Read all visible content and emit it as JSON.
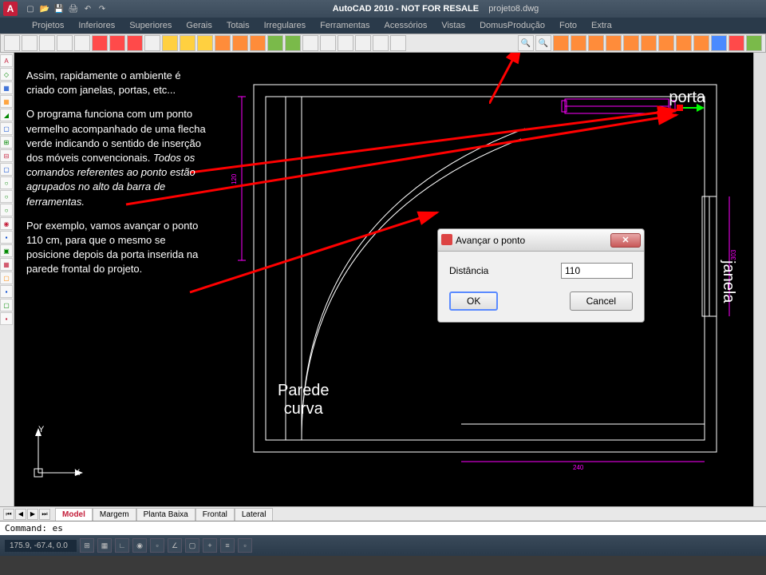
{
  "title": {
    "app": "AutoCAD 2010 - NOT FOR RESALE",
    "file": "projeto8.dwg",
    "logo": "A"
  },
  "menus": [
    "Projetos",
    "Inferiores",
    "Superiores",
    "Gerais",
    "Totais",
    "Irregulares",
    "Ferramentas",
    "Acessórios",
    "Vistas",
    "DomusProdução",
    "Foto",
    "Extra"
  ],
  "annotation": {
    "p1": "Assim, rapidamente o ambiente é criado com janelas, portas, etc...",
    "p2": "O programa funciona com um ponto vermelho acompanhado de uma flecha verde indicando o sentido de inserção dos móveis convencionais.",
    "p3": "Todos os comandos referentes ao ponto estão agrupados no alto da barra de ferramentas.",
    "p4": "Por exemplo, vamos avançar o ponto 110 cm, para que o mesmo se posicione depois da porta inserida na parede frontal do projeto."
  },
  "labels": {
    "porta": "porta",
    "janela": "janela",
    "parede": "Parede\ncurva"
  },
  "dialog": {
    "title": "Avançar o ponto",
    "field_label": "Distância",
    "field_value": "110",
    "ok": "OK",
    "cancel": "Cancel"
  },
  "tabs": {
    "active": "Model",
    "others": [
      "Margem",
      "Planta Baixa",
      "Frontal",
      "Lateral"
    ]
  },
  "command": "Command: es",
  "status": {
    "coords": "175.9, -67.4, 0.0"
  },
  "ucs": {
    "x": "X",
    "y": "Y"
  },
  "dims": {
    "d1": "120",
    "d2": "303",
    "d3": "240"
  }
}
